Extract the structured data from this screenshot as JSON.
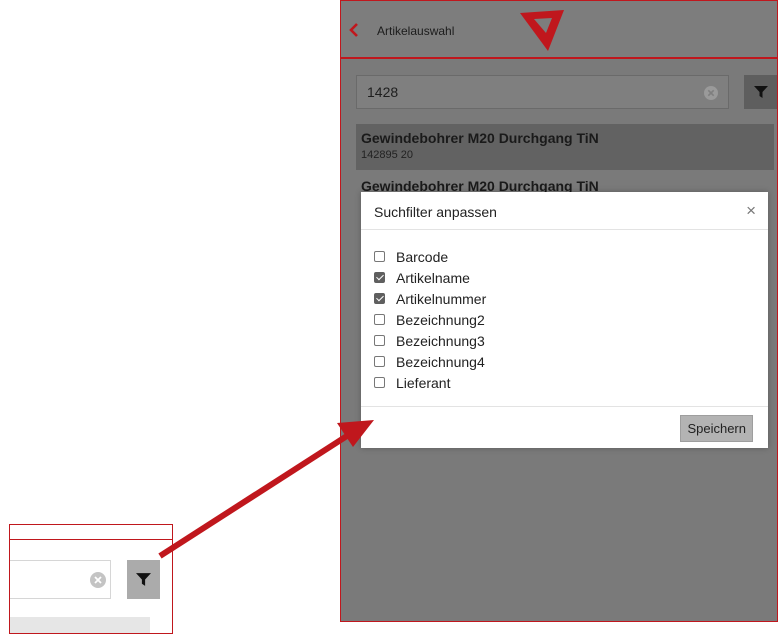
{
  "header": {
    "title": "Artikelauswahl"
  },
  "search": {
    "value": "1428"
  },
  "results": [
    {
      "name": "Gewindebohrer M20 Durchgang TiN",
      "number": "142895 20"
    },
    {
      "name": "Gewindebohrer M20 Durchgang TiN",
      "number": ""
    }
  ],
  "modal": {
    "title": "Suchfilter anpassen",
    "close": "×",
    "options": [
      {
        "label": "Barcode",
        "checked": false
      },
      {
        "label": "Artikelname",
        "checked": true
      },
      {
        "label": "Artikelnummer",
        "checked": true
      },
      {
        "label": "Bezeichnung2",
        "checked": false
      },
      {
        "label": "Bezeichnung3",
        "checked": false
      },
      {
        "label": "Bezeichnung4",
        "checked": false
      },
      {
        "label": "Lieferant",
        "checked": false
      }
    ],
    "save": "Speichern"
  },
  "icons": {
    "back": "chevron-left-icon",
    "clear": "clear-circle-icon",
    "filter": "filter-funnel-icon",
    "logo": "triangle-logo"
  },
  "colors": {
    "accent": "#c0171d"
  }
}
